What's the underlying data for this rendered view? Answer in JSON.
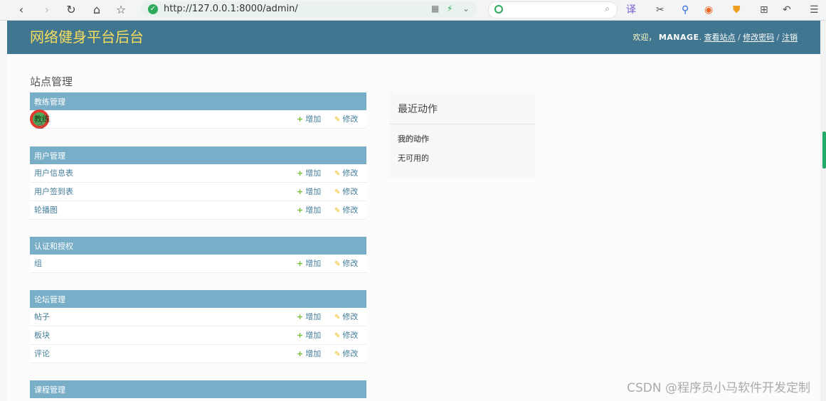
{
  "browser": {
    "url": "http://127.0.0.1:8000/admin/",
    "nav": {
      "back_icon": "‹",
      "forward_icon": "›",
      "reload_icon": "↻",
      "home_icon": "⌂",
      "star_icon": "☆"
    },
    "search_placeholder": ""
  },
  "header": {
    "site_title": "网络健身平台后台",
    "welcome": "欢迎，",
    "username": "MANAGE",
    "view_site": "查看站点",
    "change_password": "修改密码",
    "logout": "注销",
    "separator": "/"
  },
  "page": {
    "title": "站点管理",
    "add_label": "增加",
    "change_label": "修改"
  },
  "modules": [
    {
      "caption": "教练管理",
      "models": [
        "教练"
      ]
    },
    {
      "caption": "用户管理",
      "models": [
        "用户信息表",
        "用户签到表",
        "轮播图"
      ]
    },
    {
      "caption": "认证和授权",
      "models": [
        "组"
      ]
    },
    {
      "caption": "论坛管理",
      "models": [
        "帖子",
        "板块",
        "评论"
      ]
    },
    {
      "caption": "课程管理",
      "models": []
    }
  ],
  "recent_actions": {
    "title": "最近动作",
    "my_actions": "我的动作",
    "none_available": "无可用的"
  },
  "watermark": "CSDN @程序员小马软件开发定制",
  "colors": {
    "header_bg": "#417690",
    "site_title": "#f5dd5d",
    "module_caption_bg": "#79aec8",
    "link": "#447e9b",
    "add_icon": "#70bf2b",
    "change_icon": "#efb80b"
  }
}
